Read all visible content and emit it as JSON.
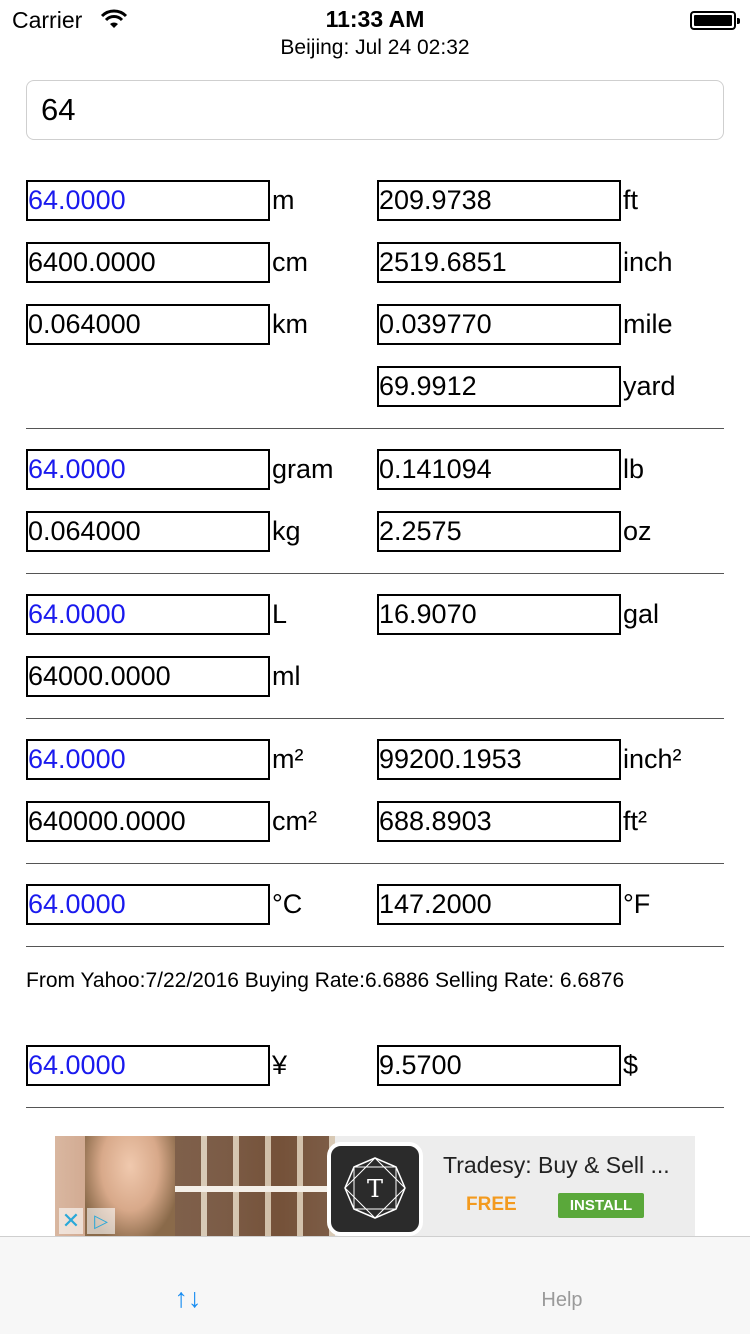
{
  "status_bar": {
    "carrier": "Carrier",
    "time": "11:33 AM",
    "subtitle": "Beijing: Jul 24 02:32"
  },
  "input": {
    "value": "64"
  },
  "length": {
    "m": {
      "value": "64.0000",
      "unit": "m"
    },
    "cm": {
      "value": "6400.0000",
      "unit": "cm"
    },
    "km": {
      "value": "0.064000",
      "unit": "km"
    },
    "ft": {
      "value": "209.9738",
      "unit": "ft"
    },
    "inch": {
      "value": "2519.6851",
      "unit": "inch"
    },
    "mile": {
      "value": "0.039770",
      "unit": "mile"
    },
    "yard": {
      "value": "69.9912",
      "unit": "yard"
    }
  },
  "weight": {
    "gram": {
      "value": "64.0000",
      "unit": "gram"
    },
    "kg": {
      "value": "0.064000",
      "unit": "kg"
    },
    "lb": {
      "value": "0.141094",
      "unit": "lb"
    },
    "oz": {
      "value": "2.2575",
      "unit": "oz"
    }
  },
  "volume": {
    "L": {
      "value": "64.0000",
      "unit": "L"
    },
    "ml": {
      "value": "64000.0000",
      "unit": "ml"
    },
    "gal": {
      "value": "16.9070",
      "unit": "gal"
    }
  },
  "area": {
    "m2": {
      "value": "64.0000",
      "unit": "m²"
    },
    "cm2": {
      "value": "640000.0000",
      "unit": "cm²"
    },
    "inch2": {
      "value": "99200.1953",
      "unit": "inch²"
    },
    "ft2": {
      "value": "688.8903",
      "unit": "ft²"
    }
  },
  "temperature": {
    "c": {
      "value": "64.0000",
      "unit": "°C"
    },
    "f": {
      "value": "147.2000",
      "unit": "°F"
    }
  },
  "currency": {
    "rate_text": "From Yahoo:7/22/2016 Buying Rate:6.6886 Selling Rate: 6.6876",
    "cny": {
      "value": "64.0000",
      "unit": "¥"
    },
    "usd": {
      "value": "9.5700",
      "unit": "$"
    }
  },
  "ad": {
    "title": "Tradesy: Buy & Sell ...",
    "price": "FREE",
    "install": "INSTALL",
    "logo_letter": "T"
  },
  "tab_bar": {
    "swap": "↑↓",
    "help": "Help"
  },
  "colors": {
    "highlight_text": "#1a1aee",
    "tab_active": "#1a8ef2",
    "install_button": "#5aa83a",
    "free_label": "#f39a1e"
  }
}
